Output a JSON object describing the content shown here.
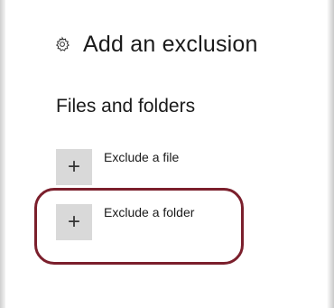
{
  "header": {
    "title": "Add an exclusion",
    "icon": "gear-icon"
  },
  "section": {
    "title": "Files and folders"
  },
  "actions": [
    {
      "label": "Exclude a file",
      "icon": "plus-icon",
      "symbol": "+"
    },
    {
      "label": "Exclude a folder",
      "icon": "plus-icon",
      "symbol": "+"
    }
  ],
  "colors": {
    "tile_background": "#d9d9d9",
    "highlight": "#7b1f2c"
  }
}
